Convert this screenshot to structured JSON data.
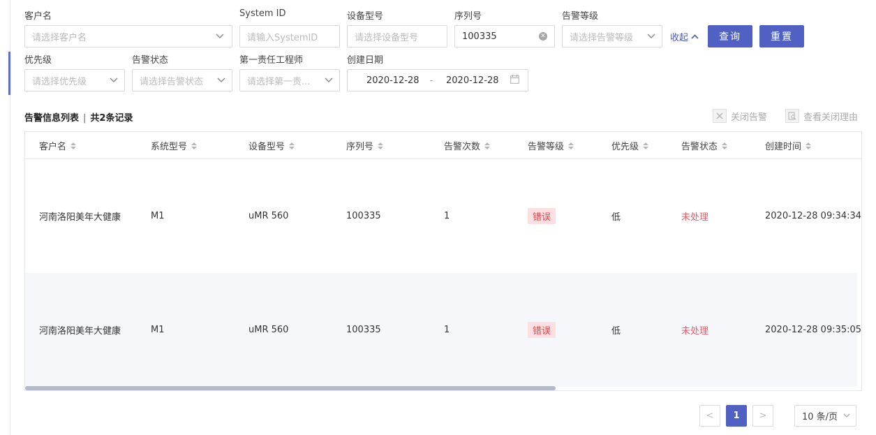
{
  "filters": {
    "customer": {
      "label": "客户名",
      "placeholder": "请选择客户名"
    },
    "system_id": {
      "label": "System ID",
      "placeholder": "请输入SystemID"
    },
    "device_model": {
      "label": "设备型号",
      "placeholder": "请选择设备型号"
    },
    "serial": {
      "label": "序列号",
      "value": "100335"
    },
    "alarm_level": {
      "label": "告警等级",
      "placeholder": "请选择告警等级"
    },
    "priority": {
      "label": "优先级",
      "placeholder": "请选择优先级"
    },
    "alarm_status": {
      "label": "告警状态",
      "placeholder": "请选择告警状态"
    },
    "engineer": {
      "label": "第一责任工程师",
      "placeholder": "请选择第一责..."
    },
    "created_date": {
      "label": "创建日期",
      "start": "2020-12-28",
      "separator": "-",
      "end": "2020-12-28"
    }
  },
  "actions": {
    "collapse": "收起",
    "query": "查询",
    "reset": "重置"
  },
  "list": {
    "title": "告警信息列表",
    "separator": "|",
    "count_text": "共2条记录",
    "close_alarm": "关闭告警",
    "view_close_reason": "查看关闭理由"
  },
  "table": {
    "columns": [
      "客户名",
      "系统型号",
      "设备型号",
      "序列号",
      "告警次数",
      "告警等级",
      "优先级",
      "告警状态",
      "创建时间"
    ],
    "rows": [
      {
        "customer": "河南洛阳美年大健康",
        "system_model": "M1",
        "device_model": "uMR 560",
        "serial": "100335",
        "count": "1",
        "level": "错误",
        "priority": "低",
        "status": "未处理",
        "created": "2020-12-28 09:34:34"
      },
      {
        "customer": "河南洛阳美年大健康",
        "system_model": "M1",
        "device_model": "uMR 560",
        "serial": "100335",
        "count": "1",
        "level": "错误",
        "priority": "低",
        "status": "未处理",
        "created": "2020-12-28 09:35:05"
      }
    ]
  },
  "pagination": {
    "prev": "<",
    "current": "1",
    "next": ">",
    "page_size": "10 条/页"
  },
  "colors": {
    "primary": "#5060c3",
    "error_tag_bg": "#fcdfe0",
    "error_text": "#e0454f"
  }
}
